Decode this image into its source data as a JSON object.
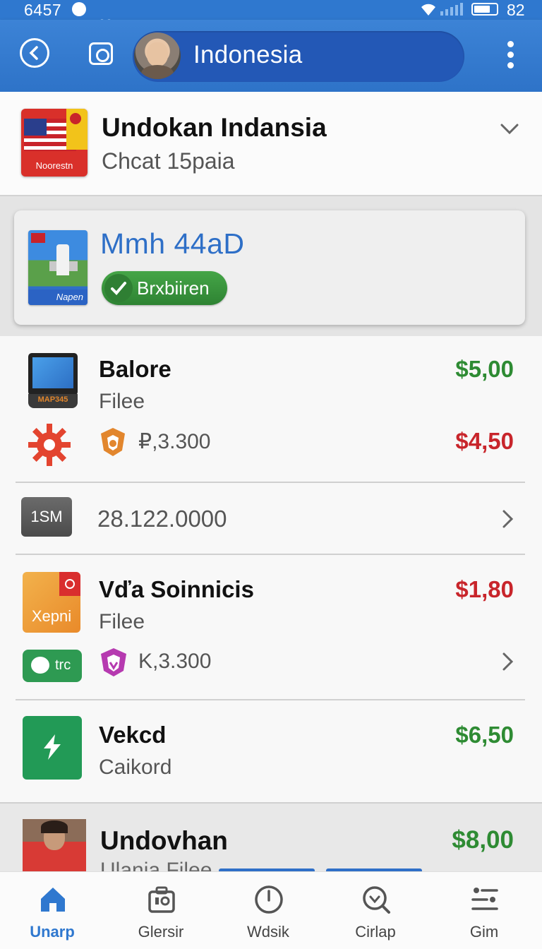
{
  "status_bar": {
    "time": "6457",
    "battery": "82"
  },
  "app_bar": {
    "title": "Indonesia"
  },
  "header": {
    "title": "Undokan Indansia",
    "subtitle": "Chcat 15paia",
    "flag_tile_label": "Noorestn"
  },
  "featured": {
    "title": "Mmh 44aD",
    "thumb_label": "Napen",
    "badge_label": "Brxbiiren",
    "badge_color": "#3a9a3e"
  },
  "items": [
    {
      "title": "Balore",
      "subtitle": "Filee",
      "price": "$5,00",
      "price_color": "green",
      "monitor_label": "MAP345",
      "secondary_value": "₽,3.300",
      "secondary_price": "$4,50",
      "secondary_price_color": "red"
    },
    {
      "chip_label": "1SM",
      "value": "28.122.0000"
    },
    {
      "title": "Vďa Soinnicis",
      "subtitle": "Filee",
      "price": "$1,80",
      "price_color": "red",
      "tile_label": "Xepni",
      "chat_label": "trc",
      "secondary_value": "K,3.300"
    },
    {
      "title": "Vekcd",
      "subtitle": "Caikord",
      "price": "$6,50",
      "price_color": "green"
    }
  ],
  "preview": {
    "title": "Undovhan",
    "subtitle": "Ulania Filee",
    "price": "$8,00"
  },
  "bottom_nav": [
    {
      "label": "Unarp",
      "icon": "home-icon",
      "active": true
    },
    {
      "label": "Glersir",
      "icon": "briefcase-icon",
      "active": false
    },
    {
      "label": "Wdsik",
      "icon": "clock-icon",
      "active": false
    },
    {
      "label": "Cirlap",
      "icon": "search-heart-icon",
      "active": false
    },
    {
      "label": "Gim",
      "icon": "settings-sliders-icon",
      "active": false
    }
  ],
  "colors": {
    "primary": "#2f78cf",
    "green": "#2e8b33",
    "red": "#c8252b"
  }
}
